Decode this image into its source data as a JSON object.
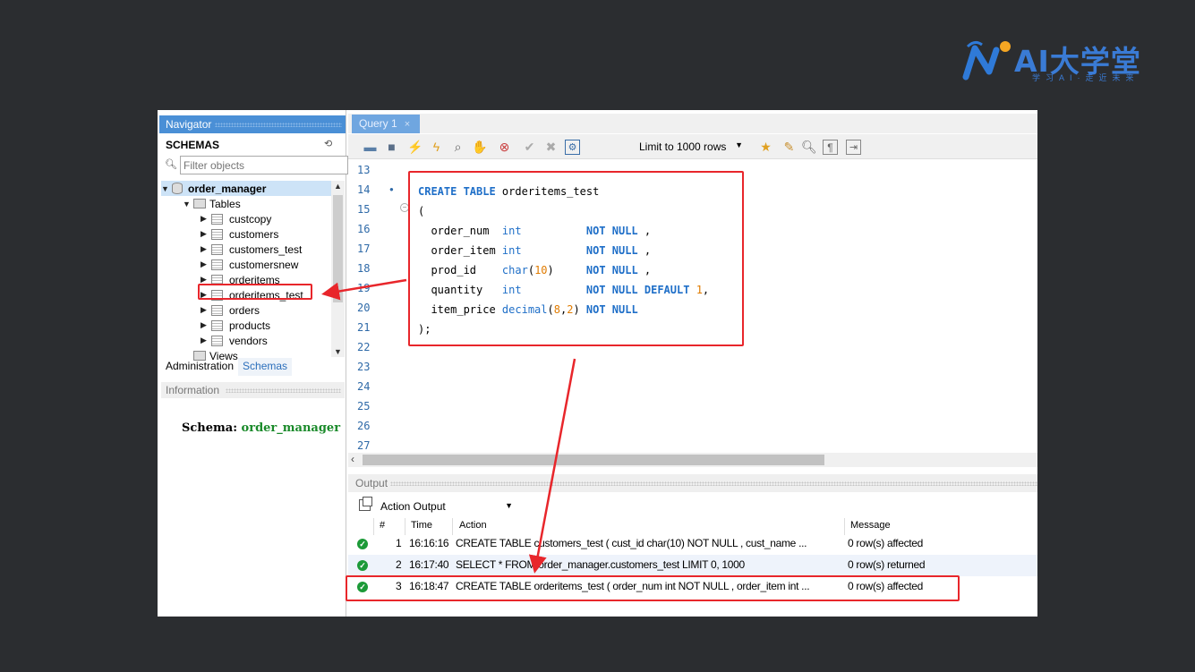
{
  "logo": {
    "text": "AI大学堂",
    "subtitle": "学习AI·走近未来"
  },
  "navigator": {
    "title": "Navigator",
    "schemas_label": "SCHEMAS",
    "filter_placeholder": "Filter objects",
    "schema": "order_manager",
    "tables_label": "Tables",
    "tables": [
      "custcopy",
      "customers",
      "customers_test",
      "customersnew",
      "orderitems",
      "orderitems_test",
      "orders",
      "products",
      "vendors"
    ],
    "views_label": "Views",
    "tabs": [
      "Administration",
      "Schemas"
    ],
    "information_title": "Information",
    "schema_info_label": "Schema:",
    "schema_info_value": "order_manager"
  },
  "query_tab": {
    "label": "Query 1",
    "close": "×"
  },
  "toolbar": {
    "limit_label": "Limit to 1000 rows"
  },
  "editor": {
    "line_numbers": [
      "13",
      "14",
      "15",
      "16",
      "17",
      "18",
      "19",
      "20",
      "21",
      "22",
      "23",
      "24",
      "25",
      "26",
      "27"
    ]
  },
  "output": {
    "title": "Output",
    "selector": "Action Output",
    "columns": [
      "#",
      "Time",
      "Action",
      "Message"
    ],
    "rows": [
      {
        "n": "1",
        "time": "16:16:16",
        "action": "CREATE TABLE customers_test (  cust_id      char(10)  NOT NULL ,   cust_name    ...",
        "message": "0 row(s) affected"
      },
      {
        "n": "2",
        "time": "16:17:40",
        "action": "SELECT * FROM order_manager.customers_test LIMIT 0, 1000",
        "message": "0 row(s) returned"
      },
      {
        "n": "3",
        "time": "16:18:47",
        "action": "CREATE TABLE orderitems_test (  order_num  int          NOT NULL ,   order_item int ...",
        "message": "0 row(s) affected"
      }
    ]
  },
  "colors": {
    "accent_red": "#e8262b",
    "keyword_blue": "#1f6fc8",
    "number_orange": "#e07b00",
    "ok_green": "#1c9a38"
  }
}
